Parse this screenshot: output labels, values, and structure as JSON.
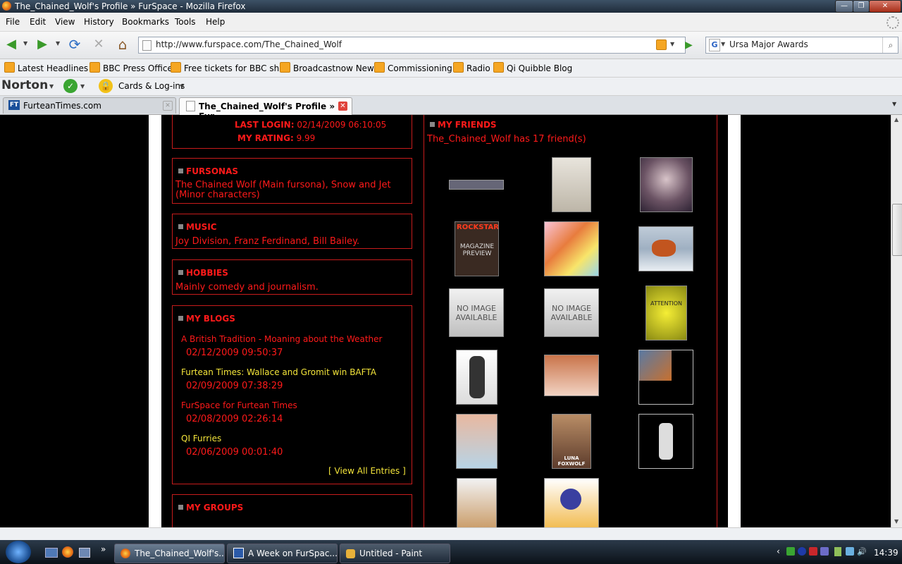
{
  "window": {
    "title": "The_Chained_Wolf's Profile » FurSpace - Mozilla Firefox"
  },
  "menu": [
    "File",
    "Edit",
    "View",
    "History",
    "Bookmarks",
    "Tools",
    "Help"
  ],
  "nav": {
    "url": "http://www.furspace.com/The_Chained_Wolf",
    "search_value": "Ursa Major Awards"
  },
  "bookmarks": [
    "Latest Headlines",
    "BBC Press Office",
    "Free tickets for BBC sh...",
    "Broadcastnow News",
    "Commissioning",
    "Radio",
    "Qi Quibble Blog"
  ],
  "norton": {
    "brand": "Norton",
    "cards": "Cards & Log-ins"
  },
  "tabs": [
    {
      "label": "FurteanTimes.com",
      "favicon": "FT"
    },
    {
      "label": "The_Chained_Wolf's Profile » Fur..."
    }
  ],
  "profile": {
    "last_login_label": "LAST LOGIN:",
    "last_login": "02/14/2009 06:10:05",
    "rating_label": "MY RATING:",
    "rating": "9.99"
  },
  "fursonas": {
    "title": "FURSONAS",
    "text": "The Chained Wolf (Main fursona), Snow and Jet (Minor characters)"
  },
  "music": {
    "title": "MUSIC",
    "text": "Joy Division, Franz Ferdinand, Bill Bailey."
  },
  "hobbies": {
    "title": "HOBBIES",
    "text": "Mainly comedy and journalism."
  },
  "blogs": {
    "title": "MY BLOGS",
    "entries": [
      {
        "title": "A British Tradition - Moaning about the Weather",
        "date": "02/12/2009 09:50:37"
      },
      {
        "title": "Furtean Times: Wallace and Gromit win BAFTA",
        "date": "02/09/2009 07:38:29"
      },
      {
        "title": "FurSpace for Furtean Times",
        "date": "02/08/2009 02:26:14"
      },
      {
        "title": "QI Furries",
        "date": "02/06/2009 00:01:40"
      }
    ],
    "view_all": "[ View All Entries ]"
  },
  "groups": {
    "title": "MY GROUPS"
  },
  "friends": {
    "title": "MY FRIENDS",
    "count_text": "The_Chained_Wolf has 17 friend(s)",
    "no_image_1": "NO IMAGE",
    "no_image_2": "AVAILABLE",
    "rockstar": "ROCKSTAR",
    "preview": "MAGAZINE PREVIEW",
    "luna": "LUNA FOXWOLF",
    "attention": "ATTENTION"
  },
  "taskbar": {
    "items": [
      "The_Chained_Wolf's...",
      "A Week on FurSpac...",
      "Untitled - Paint"
    ],
    "clock": "14:39"
  },
  "colors": {
    "accent_red": "#ff1a1a",
    "link_yellow": "#f3e43a",
    "border_red": "#c71c1c"
  }
}
